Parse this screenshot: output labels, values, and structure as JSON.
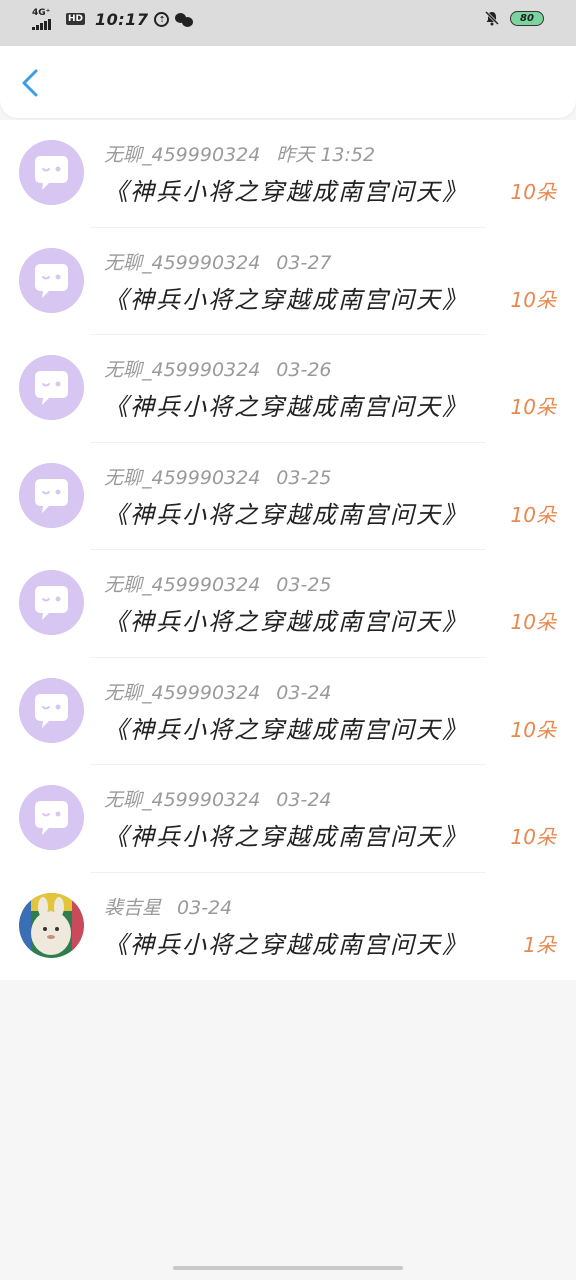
{
  "status_bar": {
    "network": "4G⁺",
    "hd": "HD",
    "time": "10:17",
    "battery": "80",
    "icons": [
      "signal-icon",
      "hd-icon",
      "sync-icon",
      "wechat-icon",
      "mute-bell-icon",
      "battery-icon"
    ]
  },
  "header": {
    "back_icon": "chevron-left-icon"
  },
  "colors": {
    "accent_blue": "#3a9ee4",
    "count_orange": "#e8884e",
    "bot_avatar": "#d8c6f2"
  },
  "messages": [
    {
      "sender": "无聊_459990324",
      "date": "昨天 13:52",
      "title": "《神兵小将之穿越成南宫问天》",
      "count": "10朵",
      "avatar": "chat-bubble-avatar"
    },
    {
      "sender": "无聊_459990324",
      "date": "03-27",
      "title": "《神兵小将之穿越成南宫问天》",
      "count": "10朵",
      "avatar": "chat-bubble-avatar"
    },
    {
      "sender": "无聊_459990324",
      "date": "03-26",
      "title": "《神兵小将之穿越成南宫问天》",
      "count": "10朵",
      "avatar": "chat-bubble-avatar"
    },
    {
      "sender": "无聊_459990324",
      "date": "03-25",
      "title": "《神兵小将之穿越成南宫问天》",
      "count": "10朵",
      "avatar": "chat-bubble-avatar"
    },
    {
      "sender": "无聊_459990324",
      "date": "03-25",
      "title": "《神兵小将之穿越成南宫问天》",
      "count": "10朵",
      "avatar": "chat-bubble-avatar"
    },
    {
      "sender": "无聊_459990324",
      "date": "03-24",
      "title": "《神兵小将之穿越成南宫问天》",
      "count": "10朵",
      "avatar": "chat-bubble-avatar"
    },
    {
      "sender": "无聊_459990324",
      "date": "03-24",
      "title": "《神兵小将之穿越成南宫问天》",
      "count": "10朵",
      "avatar": "chat-bubble-avatar"
    },
    {
      "sender": "裴吉星",
      "date": "03-24",
      "title": "《神兵小将之穿越成南宫问天》",
      "count": "1朵",
      "avatar": "user-photo-avatar"
    }
  ]
}
